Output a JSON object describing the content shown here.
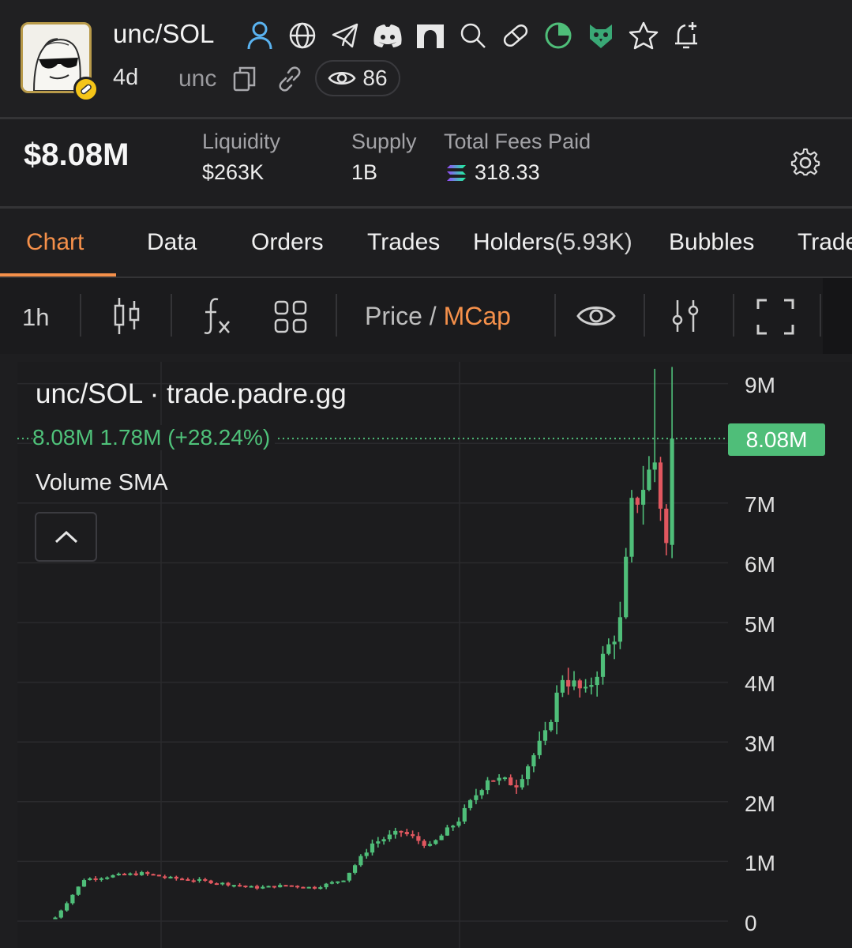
{
  "header": {
    "pair": "unc/SOL",
    "age": "4d",
    "ticker": "unc",
    "watchers": "86",
    "icons": [
      "user-icon",
      "globe-icon",
      "telegram-icon",
      "discord-icon",
      "gate-icon",
      "search-icon",
      "pill-icon",
      "pie-chart-icon",
      "owl-icon",
      "star-icon",
      "bell-plus-icon"
    ]
  },
  "stats": {
    "market_cap": "$8.08M",
    "liquidity_label": "Liquidity",
    "liquidity_value": "$263K",
    "supply_label": "Supply",
    "supply_value": "1B",
    "fees_label": "Total Fees Paid",
    "fees_value": "318.33"
  },
  "tabs": {
    "chart": "Chart",
    "data": "Data",
    "orders": "Orders",
    "trades": "Trades",
    "holders": "Holders",
    "holders_count": "(5.93K)",
    "bubbles": "Bubbles",
    "traders_partial": "Trade"
  },
  "toolbar": {
    "interval": "1h",
    "price": "Price",
    "separator": "/",
    "mcap": "MCap"
  },
  "chart": {
    "legend_title": "unc/SOL · trade.padre.gg",
    "legend_values": "8.08M  1.78M (+28.24%)",
    "indicator": "Volume SMA",
    "current_price_label": "8.08M",
    "y_ticks": [
      "9M",
      "7M",
      "6M",
      "5M",
      "4M",
      "3M",
      "2M",
      "1M",
      "0"
    ],
    "colors": {
      "up": "#4fbe79",
      "down": "#e0575f",
      "accent": "#f5904a"
    }
  },
  "chart_data": {
    "type": "candlestick",
    "title": "unc/SOL · trade.padre.gg",
    "unit": "market cap (USD)",
    "ylim": [
      0,
      9000000
    ],
    "last": 8080000,
    "change": "1.78M (+28.24%)",
    "approx_close_path": [
      [
        0,
        60000
      ],
      [
        5,
        700000
      ],
      [
        10,
        760000
      ],
      [
        15,
        800000
      ],
      [
        20,
        720000
      ],
      [
        25,
        680000
      ],
      [
        30,
        620000
      ],
      [
        35,
        560000
      ],
      [
        40,
        600000
      ],
      [
        45,
        560000
      ],
      [
        50,
        700000
      ],
      [
        55,
        1300000
      ],
      [
        60,
        1500000
      ],
      [
        65,
        1250000
      ],
      [
        70,
        1700000
      ],
      [
        75,
        2400000
      ],
      [
        80,
        2300000
      ],
      [
        85,
        3100000
      ],
      [
        88,
        4100000
      ],
      [
        92,
        3800000
      ],
      [
        96,
        4600000
      ],
      [
        98,
        5000000
      ],
      [
        100,
        6900000
      ],
      [
        102,
        7300000
      ],
      [
        104,
        7700000
      ],
      [
        106,
        6300000
      ],
      [
        107,
        8080000
      ]
    ]
  }
}
